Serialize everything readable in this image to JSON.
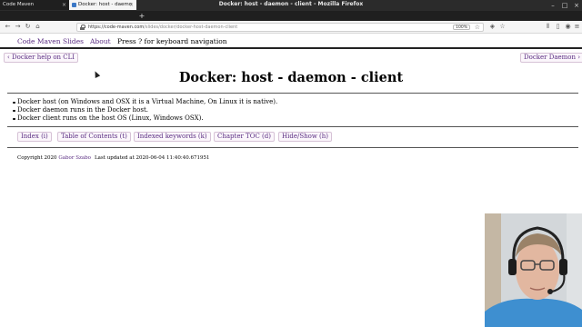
{
  "window": {
    "title": "Docker: host - daemon - client - Mozilla Firefox"
  },
  "tabs": [
    {
      "label": "Code Maven",
      "active": false
    },
    {
      "label": "Docker: host - daemo",
      "active": true
    }
  ],
  "browser": {
    "url_domain": "https://code-maven.com",
    "url_path": "/slides/docker/docker-host-daemon-client",
    "zoom": "100%"
  },
  "topnav": {
    "links": [
      "Code Maven",
      "Slides",
      "About"
    ],
    "hint": "Press ? for keyboard navigation"
  },
  "pager": {
    "prev": "‹ Docker help on CLI",
    "next": "Docker Daemon ›"
  },
  "page": {
    "title": "Docker: host - daemon - client",
    "bullets": [
      "Docker host (on Windows and OSX it is a Virtual Machine, On Linux it is native).",
      "Docker daemon runs in the Docker host.",
      "Docker client runs on the host OS (Linux, Windows OSX)."
    ]
  },
  "buttons": [
    "Index (i)",
    "Table of Contents (t)",
    "Indexed keywords (k)",
    "Chapter TOC (d)",
    "Hide/Show (h)"
  ],
  "footer": {
    "copyright": "Copyright 2020",
    "author": "Gabor Szabo",
    "updated": "Last updated at 2020-06-04 11:40:40.671951"
  },
  "colors": {
    "link": "#5a2d82",
    "chrome_dark": "#2b2b2b",
    "chrome_light": "#f5f5f5"
  }
}
